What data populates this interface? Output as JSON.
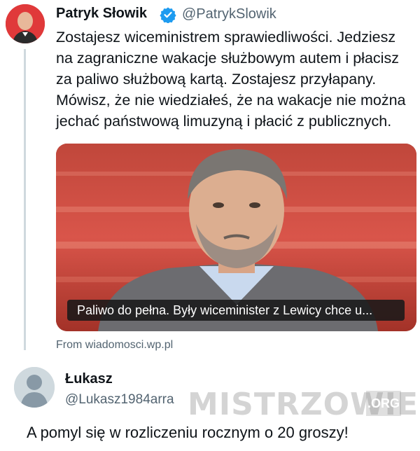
{
  "tweet": {
    "author_name": "Patryk Słowik",
    "author_handle": "@PatrykSlowik",
    "verified_icon": "verified-badge-icon",
    "text": "Zostajesz wiceministrem sprawiedliwości. Jedziesz\nna zagraniczne wakacje służbowym autem i płacisz\nza paliwo służbową kartą. Zostajesz przyłapany.\nMówisz, że nie wiedziałeś, że na wakacje nie można\njechać państwową limuzyną i płacić z publicznych.",
    "link_card": {
      "caption": "Paliwo do pełna. Były wiceminister z Lewicy chce u...",
      "source": "From wiadomosci.wp.pl"
    }
  },
  "reply": {
    "author_name": "Łukasz",
    "author_handle": "@Lukasz1984arra",
    "text": "A pomyl się w rozliczeniu rocznym o 20 groszy!"
  },
  "watermark": {
    "text": "MISTRZOWIE",
    "tld": ".ORG"
  },
  "colors": {
    "verified": "#1d9bf0",
    "secondary_text": "#536471",
    "thread_line": "#cfd9de"
  }
}
